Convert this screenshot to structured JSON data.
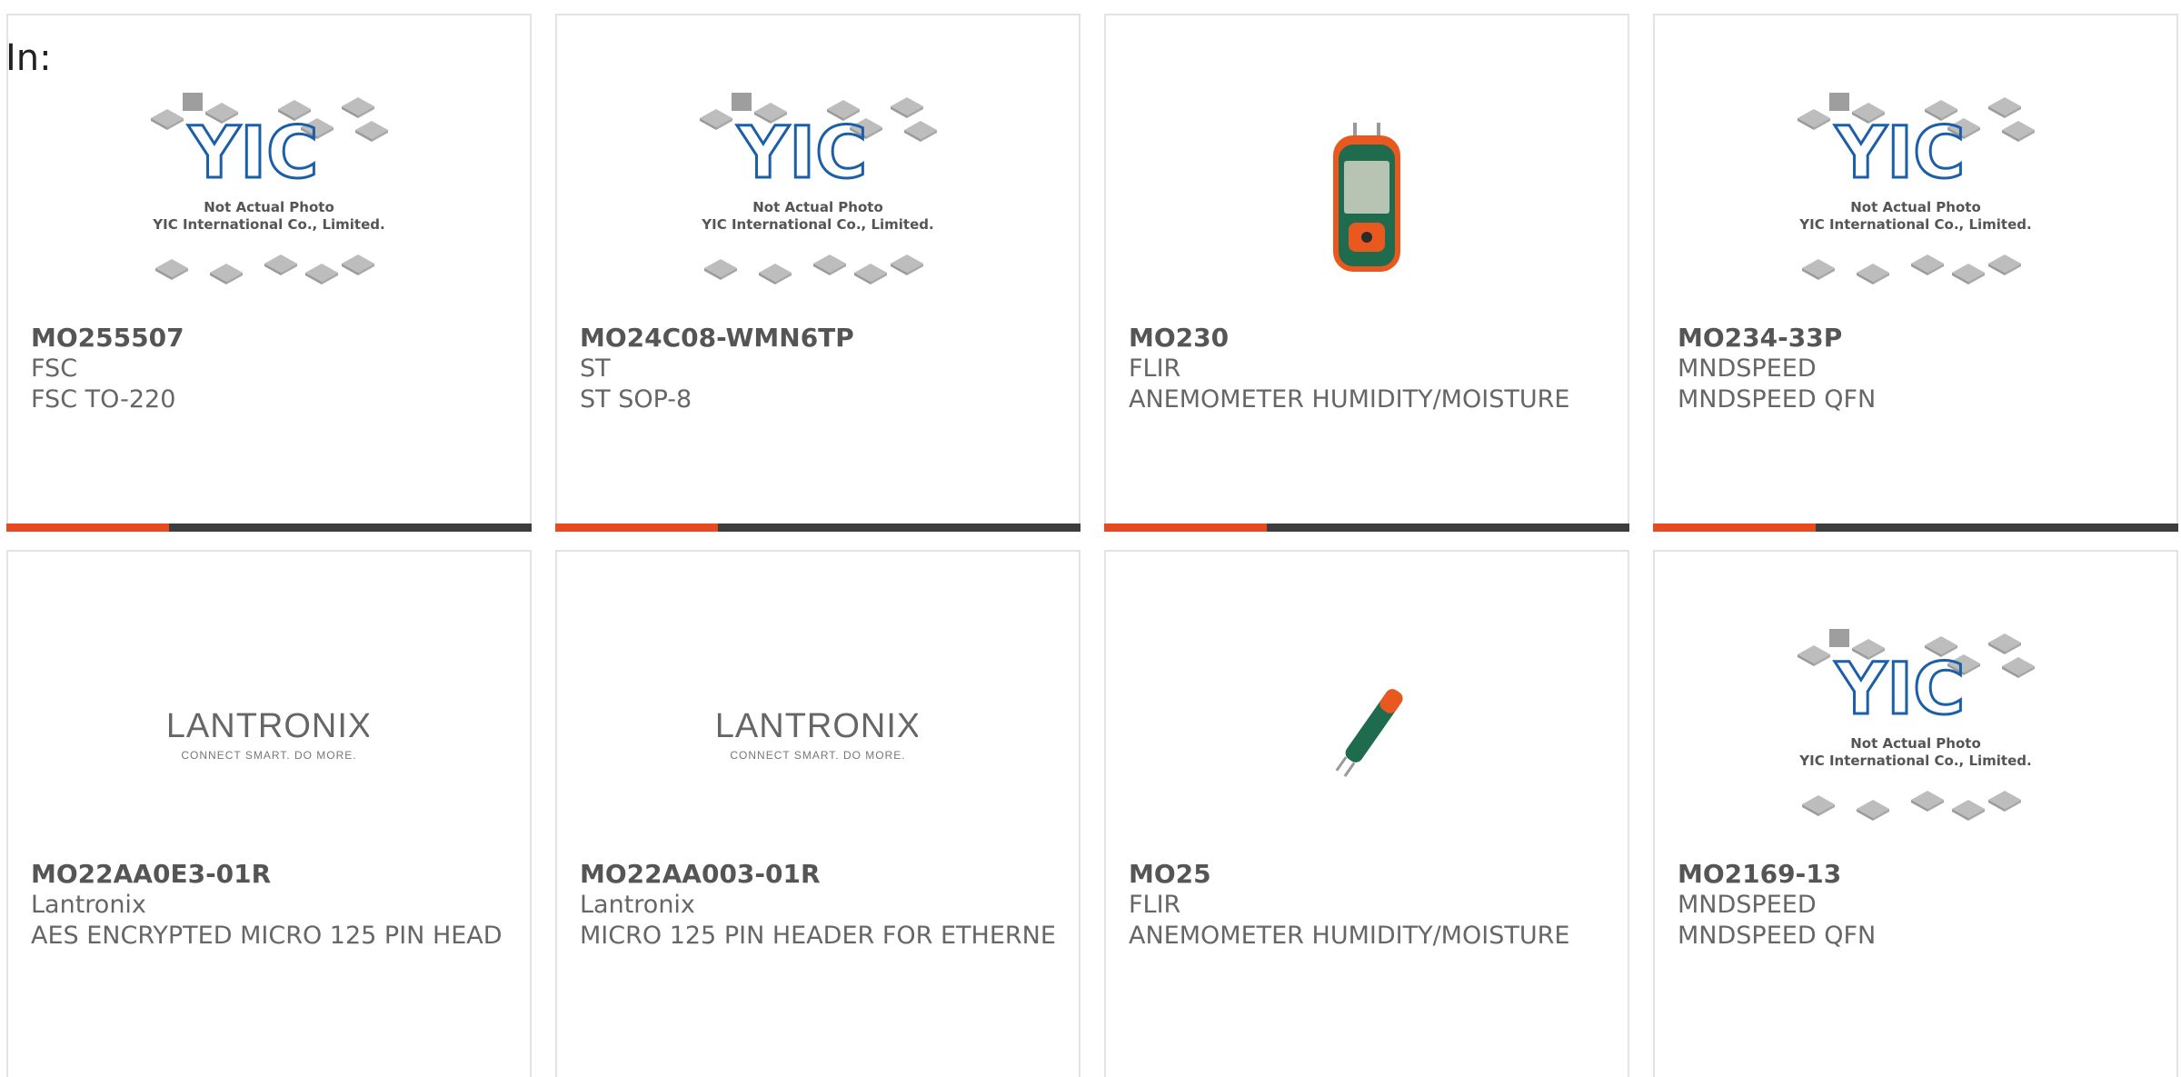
{
  "filter": {
    "label": "In:"
  },
  "placeholder_image": {
    "caption_line1": "Not Actual Photo",
    "caption_line2": "YIC International Co., Limited.",
    "logo_text": "YIC"
  },
  "lantronix_logo": {
    "brand": "LANTRONIX",
    "tagline": "CONNECT SMART. DO MORE."
  },
  "products": [
    {
      "part": "MO255507",
      "maker": "FSC",
      "desc": "FSC TO-220",
      "image": "yic-placeholder",
      "progress": 0.31
    },
    {
      "part": "MO24C08-WMN6TP",
      "maker": "ST",
      "desc": "ST SOP-8",
      "image": "yic-placeholder",
      "progress": 0.31
    },
    {
      "part": "MO230",
      "maker": "FLIR",
      "desc": "ANEMOMETER HUMIDITY/MOISTURE",
      "image": "moisture-meter",
      "progress": 0.31
    },
    {
      "part": "MO234-33P",
      "maker": "MNDSPEED",
      "desc": "MNDSPEED QFN",
      "image": "yic-placeholder",
      "progress": 0.31
    },
    {
      "part": "MO22AA0E3-01R",
      "maker": "Lantronix",
      "desc": "AES ENCRYPTED MICRO 125 PIN HEAD",
      "image": "lantronix-logo"
    },
    {
      "part": "MO22AA003-01R",
      "maker": "Lantronix",
      "desc": "MICRO 125 PIN HEADER FOR ETHERNE",
      "image": "lantronix-logo"
    },
    {
      "part": "MO25",
      "maker": "FLIR",
      "desc": "ANEMOMETER HUMIDITY/MOISTURE",
      "image": "pin-moisture-pen"
    },
    {
      "part": "MO2169-13",
      "maker": "MNDSPEED",
      "desc": "MNDSPEED QFN",
      "image": "yic-placeholder"
    }
  ],
  "colors": {
    "accent": "#e84a1f",
    "bar": "#3d3d3d",
    "border": "#e3e3e3",
    "text": "#666666",
    "yic_blue": "#1a5fa8"
  }
}
